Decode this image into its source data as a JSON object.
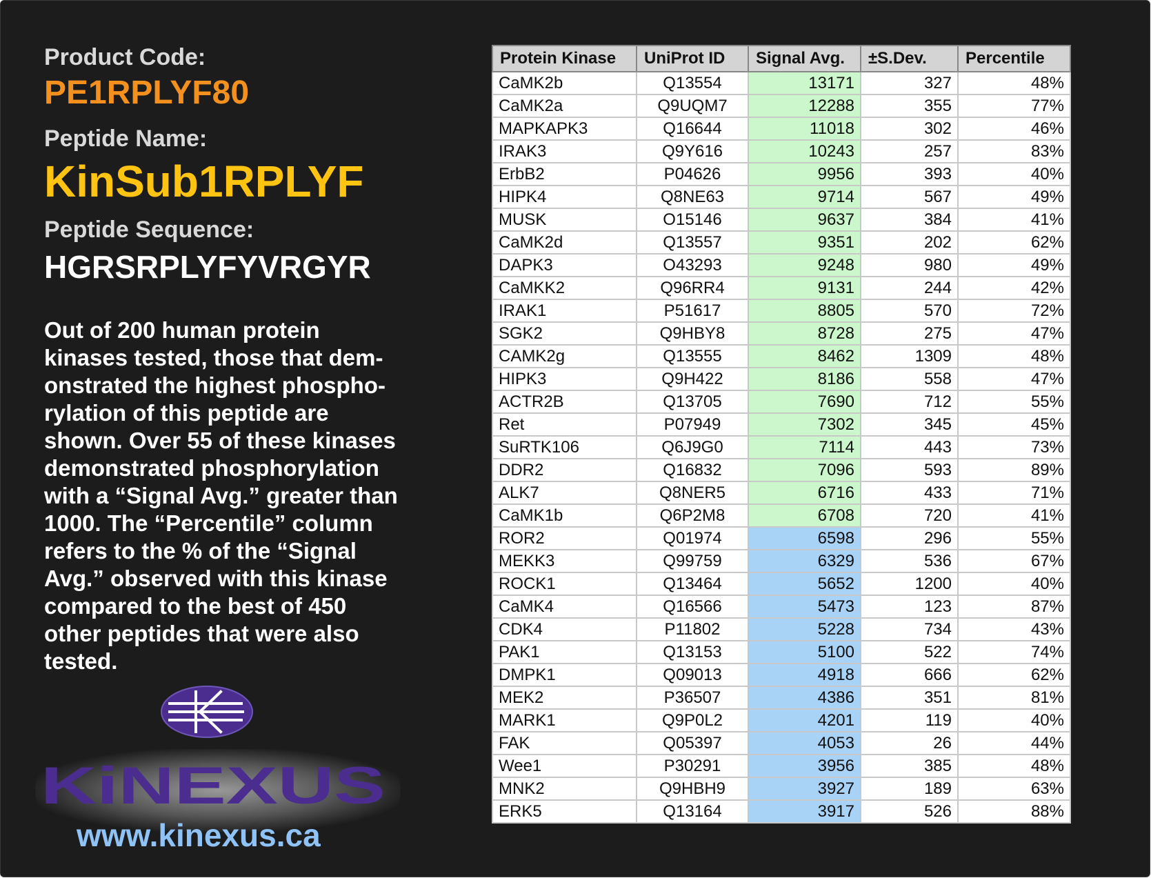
{
  "product_code_label": "Product Code:",
  "product_code": "PE1RPLYF80",
  "peptide_name_label": "Peptide Name:",
  "peptide_name": "KinSub1RPLYF",
  "peptide_sequence_label": "Peptide Sequence:",
  "peptide_sequence": "HGRSRPLYFYVRGYR",
  "description_lines": [
    "Out of 200 human protein",
    "kinases tested, those that dem-",
    "onstrated the highest phospho-",
    "rylation of this peptide are",
    "shown. Over 55 of these kinases",
    "demonstrated phosphorylation",
    "with a “Signal Avg.” greater than",
    "1000. The “Percentile” column",
    "refers to the % of the “Signal",
    "Avg.” observed with this kinase",
    "compared to the best of 450",
    "other peptides that were also",
    "tested."
  ],
  "logo_text": "KiNEXUS",
  "website": "www.kinexus.ca",
  "colors": {
    "background": "#1c1c1c",
    "product_code": "#f4901e",
    "peptide_name": "#ffc312",
    "website": "#8fc3f7",
    "logo_purple": "#4a2d8f",
    "signal_high": "#ccf7cc",
    "signal_mid": "#a9d2f7"
  },
  "table": {
    "headers": [
      "Protein Kinase",
      "UniProt ID",
      "Signal Avg.",
      "±S.Dev.",
      "Percentile"
    ],
    "rows": [
      {
        "kinase": "CaMK2b",
        "uniprot": "Q13554",
        "signal": "13171",
        "sdev": "327",
        "percentile": "48%",
        "level": "hi"
      },
      {
        "kinase": "CaMK2a",
        "uniprot": "Q9UQM7",
        "signal": "12288",
        "sdev": "355",
        "percentile": "77%",
        "level": "hi"
      },
      {
        "kinase": "MAPKAPK3",
        "uniprot": "Q16644",
        "signal": "11018",
        "sdev": "302",
        "percentile": "46%",
        "level": "hi"
      },
      {
        "kinase": "IRAK3",
        "uniprot": "Q9Y616",
        "signal": "10243",
        "sdev": "257",
        "percentile": "83%",
        "level": "hi"
      },
      {
        "kinase": "ErbB2",
        "uniprot": "P04626",
        "signal": "9956",
        "sdev": "393",
        "percentile": "40%",
        "level": "hi"
      },
      {
        "kinase": "HIPK4",
        "uniprot": "Q8NE63",
        "signal": "9714",
        "sdev": "567",
        "percentile": "49%",
        "level": "hi"
      },
      {
        "kinase": "MUSK",
        "uniprot": "O15146",
        "signal": "9637",
        "sdev": "384",
        "percentile": "41%",
        "level": "hi"
      },
      {
        "kinase": "CaMK2d",
        "uniprot": "Q13557",
        "signal": "9351",
        "sdev": "202",
        "percentile": "62%",
        "level": "hi"
      },
      {
        "kinase": "DAPK3",
        "uniprot": "O43293",
        "signal": "9248",
        "sdev": "980",
        "percentile": "49%",
        "level": "hi"
      },
      {
        "kinase": "CaMKK2",
        "uniprot": "Q96RR4",
        "signal": "9131",
        "sdev": "244",
        "percentile": "42%",
        "level": "hi"
      },
      {
        "kinase": "IRAK1",
        "uniprot": "P51617",
        "signal": "8805",
        "sdev": "570",
        "percentile": "72%",
        "level": "hi"
      },
      {
        "kinase": "SGK2",
        "uniprot": "Q9HBY8",
        "signal": "8728",
        "sdev": "275",
        "percentile": "47%",
        "level": "hi"
      },
      {
        "kinase": "CAMK2g",
        "uniprot": "Q13555",
        "signal": "8462",
        "sdev": "1309",
        "percentile": "48%",
        "level": "hi"
      },
      {
        "kinase": "HIPK3",
        "uniprot": "Q9H422",
        "signal": "8186",
        "sdev": "558",
        "percentile": "47%",
        "level": "hi"
      },
      {
        "kinase": "ACTR2B",
        "uniprot": "Q13705",
        "signal": "7690",
        "sdev": "712",
        "percentile": "55%",
        "level": "hi"
      },
      {
        "kinase": "Ret",
        "uniprot": "P07949",
        "signal": "7302",
        "sdev": "345",
        "percentile": "45%",
        "level": "hi"
      },
      {
        "kinase": "SuRTK106",
        "uniprot": "Q6J9G0",
        "signal": "7114",
        "sdev": "443",
        "percentile": "73%",
        "level": "hi"
      },
      {
        "kinase": "DDR2",
        "uniprot": "Q16832",
        "signal": "7096",
        "sdev": "593",
        "percentile": "89%",
        "level": "hi"
      },
      {
        "kinase": "ALK7",
        "uniprot": "Q8NER5",
        "signal": "6716",
        "sdev": "433",
        "percentile": "71%",
        "level": "hi"
      },
      {
        "kinase": "CaMK1b",
        "uniprot": "Q6P2M8",
        "signal": "6708",
        "sdev": "720",
        "percentile": "41%",
        "level": "hi"
      },
      {
        "kinase": "ROR2",
        "uniprot": "Q01974",
        "signal": "6598",
        "sdev": "296",
        "percentile": "55%",
        "level": "mid"
      },
      {
        "kinase": "MEKK3",
        "uniprot": "Q99759",
        "signal": "6329",
        "sdev": "536",
        "percentile": "67%",
        "level": "mid"
      },
      {
        "kinase": "ROCK1",
        "uniprot": "Q13464",
        "signal": "5652",
        "sdev": "1200",
        "percentile": "40%",
        "level": "mid"
      },
      {
        "kinase": "CaMK4",
        "uniprot": "Q16566",
        "signal": "5473",
        "sdev": "123",
        "percentile": "87%",
        "level": "mid"
      },
      {
        "kinase": "CDK4",
        "uniprot": "P11802",
        "signal": "5228",
        "sdev": "734",
        "percentile": "43%",
        "level": "mid"
      },
      {
        "kinase": "PAK1",
        "uniprot": "Q13153",
        "signal": "5100",
        "sdev": "522",
        "percentile": "74%",
        "level": "mid"
      },
      {
        "kinase": "DMPK1",
        "uniprot": "Q09013",
        "signal": "4918",
        "sdev": "666",
        "percentile": "62%",
        "level": "mid"
      },
      {
        "kinase": "MEK2",
        "uniprot": "P36507",
        "signal": "4386",
        "sdev": "351",
        "percentile": "81%",
        "level": "mid"
      },
      {
        "kinase": "MARK1",
        "uniprot": "Q9P0L2",
        "signal": "4201",
        "sdev": "119",
        "percentile": "40%",
        "level": "mid"
      },
      {
        "kinase": "FAK",
        "uniprot": "Q05397",
        "signal": "4053",
        "sdev": "26",
        "percentile": "44%",
        "level": "mid"
      },
      {
        "kinase": "Wee1",
        "uniprot": "P30291",
        "signal": "3956",
        "sdev": "385",
        "percentile": "48%",
        "level": "mid"
      },
      {
        "kinase": "MNK2",
        "uniprot": "Q9HBH9",
        "signal": "3927",
        "sdev": "189",
        "percentile": "63%",
        "level": "mid"
      },
      {
        "kinase": "ERK5",
        "uniprot": "Q13164",
        "signal": "3917",
        "sdev": "526",
        "percentile": "88%",
        "level": "mid"
      }
    ]
  }
}
